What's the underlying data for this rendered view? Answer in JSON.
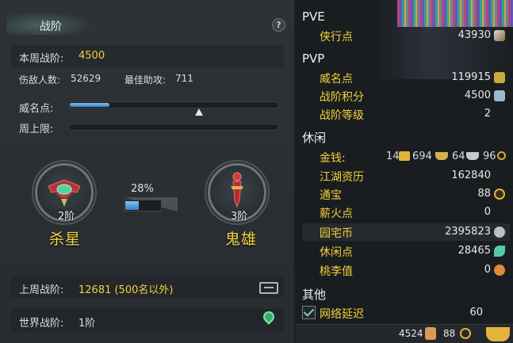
{
  "left_panel": {
    "title": "战阶",
    "help_label": "?",
    "weekly_rank": {
      "label": "本周战阶:",
      "value": "4500"
    },
    "damage_count": {
      "label": "伤敌人数:",
      "value": "52629"
    },
    "best_assist": {
      "label": "最佳助攻:",
      "value": "711"
    },
    "prestige": {
      "label": "威名点:",
      "progress": 0.19,
      "marker": 0.62
    },
    "weekly_cap": {
      "label": "周上限:",
      "progress": 0.0
    },
    "current_rank": {
      "level": "2阶",
      "name": "杀星"
    },
    "next_rank": {
      "level": "3阶",
      "name": "鬼雄"
    },
    "rank_progress": {
      "text": "28%",
      "value": 0.28
    },
    "last_week": {
      "label": "上周战阶:",
      "value": "12681 (500名以外)"
    },
    "world_rank": {
      "label": "世界战阶:",
      "value": "1阶"
    }
  },
  "right_panel": {
    "pve": {
      "header": "PVE",
      "rows": [
        {
          "key": "侠行点",
          "value": "43930",
          "icon": "sword-icon"
        }
      ]
    },
    "pvp": {
      "header": "PVP",
      "rows": [
        {
          "key": "威名点",
          "value": "119915",
          "icon": "prestige-icon"
        },
        {
          "key": "战阶积分",
          "value": "4500",
          "icon": "rank-score-icon"
        },
        {
          "key": "战阶等级",
          "value": "2"
        }
      ]
    },
    "leisure": {
      "header": "休闲",
      "money": {
        "key": "金钱:",
        "gold": "14",
        "silver": "694",
        "copper": "64",
        "ingot": "96"
      },
      "rows": [
        {
          "key": "江湖资历",
          "value": "162840"
        },
        {
          "key": "通宝",
          "value": "88",
          "icon": "coin-icon"
        },
        {
          "key": "薪火点",
          "value": "0"
        },
        {
          "key": "园宅币",
          "value": "2395823",
          "icon": "cloud-icon"
        },
        {
          "key": "休闲点",
          "value": "28465",
          "icon": "leaf-icon"
        },
        {
          "key": "桃李值",
          "value": "0",
          "icon": "gourd-icon"
        }
      ]
    },
    "other": {
      "header": "其他",
      "rows": [
        {
          "key": "网络延迟",
          "value": "60",
          "checked": true
        }
      ]
    },
    "footer": {
      "left_value": "4524",
      "coin_value": "88"
    }
  },
  "colors": {
    "accent_gold": "#f2d13a",
    "bar_blue": "#3b7fc0",
    "panel_dark": "#1a1d20"
  }
}
